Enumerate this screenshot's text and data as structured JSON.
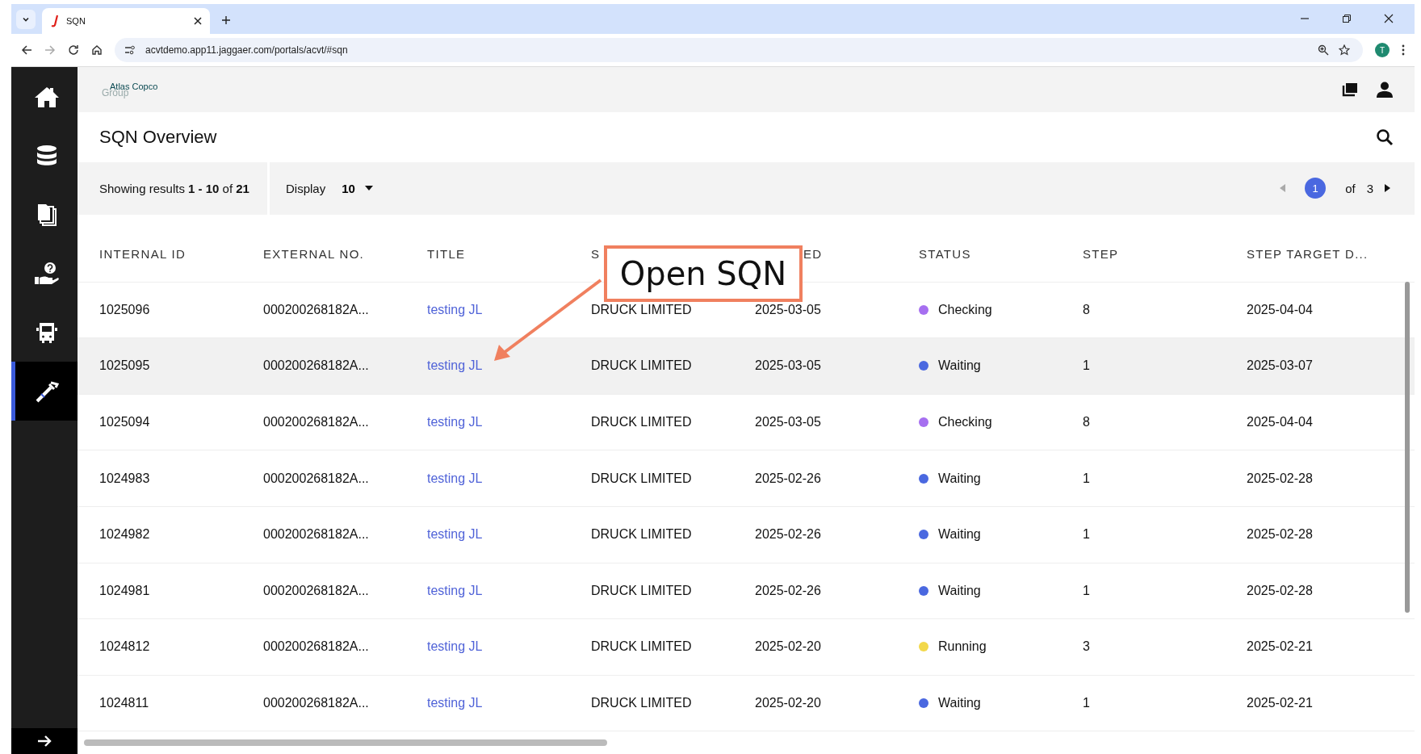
{
  "browser": {
    "tabs": [
      {
        "label": "SQN",
        "selected": true
      }
    ],
    "url": "acvtdemo.app11.jaggaer.com/portals/acvt/#sqn",
    "profile_initial": "T"
  },
  "sidebar": {
    "items": [
      {
        "selected": false
      },
      {
        "selected": false
      },
      {
        "selected": false
      },
      {
        "selected": false
      },
      {
        "selected": false
      },
      {
        "selected": true
      }
    ]
  },
  "header": {
    "logo_top": "Atlas Copco",
    "logo_bottom": "Group"
  },
  "page_title": "SQN Overview",
  "toolbar": {
    "results": "Showing results **1 - 10** of **21**",
    "display_label": "Display",
    "display_value": "10",
    "page": "1",
    "of_label": "of",
    "total_pages": "3"
  },
  "table": {
    "columns": [
      "INTERNAL ID",
      "EXTERNAL NO.",
      "TITLE",
      "S",
      "ED",
      "STATUS",
      "STEP",
      "STEP TARGET D..."
    ],
    "rows": [
      {
        "internal_id": "1025096",
        "external_no": "000200268182A...",
        "title": "testing JL",
        "supplier": "DRUCK LIMITED",
        "date": "2025-03-05",
        "status": "Checking",
        "color": "#a66ff0",
        "step": "8",
        "target": "2025-04-04",
        "selected": false
      },
      {
        "internal_id": "1025095",
        "external_no": "000200268182A...",
        "title": "testing JL",
        "supplier": "DRUCK LIMITED",
        "date": "2025-03-05",
        "status": "Waiting",
        "color": "#4a68e0",
        "step": "1",
        "target": "2025-03-07",
        "selected": true
      },
      {
        "internal_id": "1025094",
        "external_no": "000200268182A...",
        "title": "testing JL",
        "supplier": "DRUCK LIMITED",
        "date": "2025-03-05",
        "status": "Checking",
        "color": "#a66ff0",
        "step": "8",
        "target": "2025-04-04",
        "selected": false
      },
      {
        "internal_id": "1024983",
        "external_no": "000200268182A...",
        "title": "testing JL",
        "supplier": "DRUCK LIMITED",
        "date": "2025-02-26",
        "status": "Waiting",
        "color": "#4a68e0",
        "step": "1",
        "target": "2025-02-28",
        "selected": false
      },
      {
        "internal_id": "1024982",
        "external_no": "000200268182A...",
        "title": "testing JL",
        "supplier": "DRUCK LIMITED",
        "date": "2025-02-26",
        "status": "Waiting",
        "color": "#4a68e0",
        "step": "1",
        "target": "2025-02-28",
        "selected": false
      },
      {
        "internal_id": "1024981",
        "external_no": "000200268182A...",
        "title": "testing JL",
        "supplier": "DRUCK LIMITED",
        "date": "2025-02-26",
        "status": "Waiting",
        "color": "#4a68e0",
        "step": "1",
        "target": "2025-02-28",
        "selected": false
      },
      {
        "internal_id": "1024812",
        "external_no": "000200268182A...",
        "title": "testing JL",
        "supplier": "DRUCK LIMITED",
        "date": "2025-02-20",
        "status": "Running",
        "color": "#f2d84a",
        "step": "3",
        "target": "2025-02-21",
        "selected": false
      },
      {
        "internal_id": "1024811",
        "external_no": "000200268182A...",
        "title": "testing JL",
        "supplier": "DRUCK LIMITED",
        "date": "2025-02-20",
        "status": "Waiting",
        "color": "#4a68e0",
        "step": "1",
        "target": "2025-02-21",
        "selected": false
      }
    ]
  },
  "callout": {
    "text": "Open SQN"
  }
}
